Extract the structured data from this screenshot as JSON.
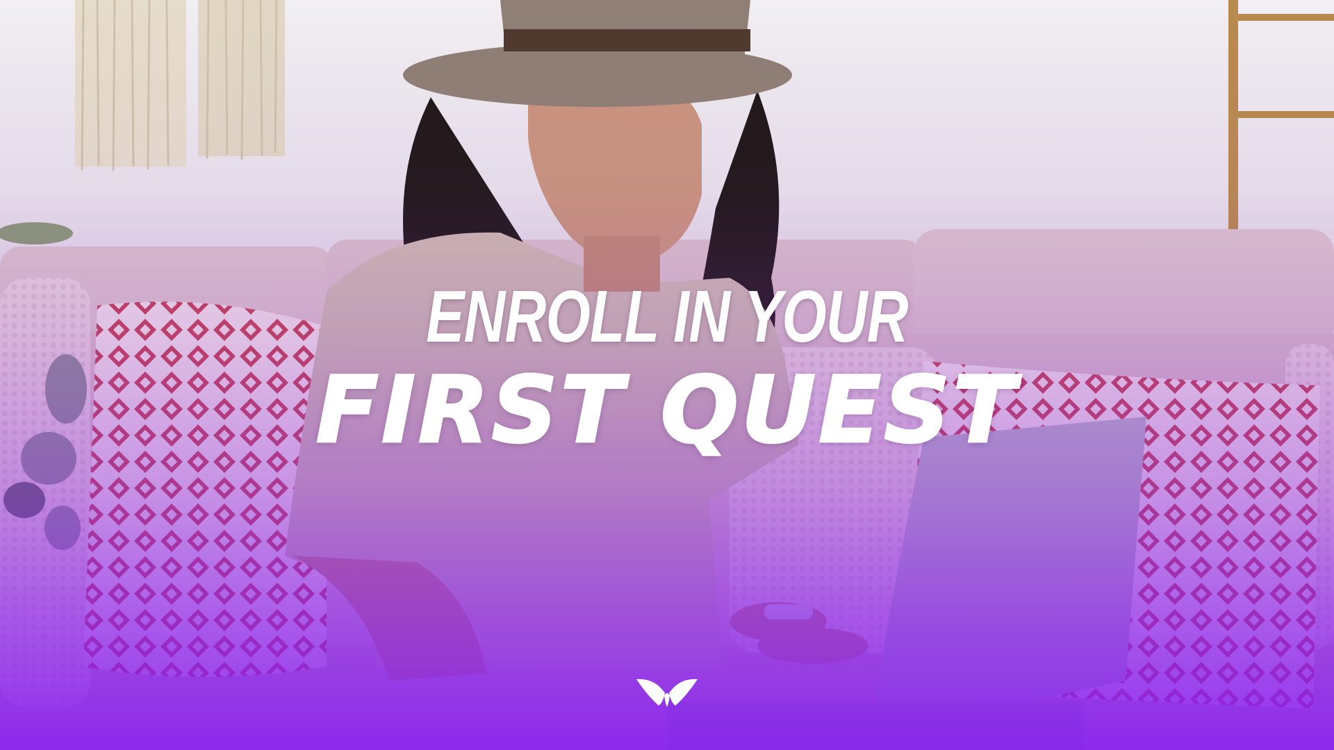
{
  "headline": {
    "line1": "ENROLL IN YOUR",
    "line2": "FIRST QUEST"
  },
  "logo": {
    "icon": "mindvalley-wings-icon"
  },
  "colors": {
    "overlay_purple": "#8a1ef0",
    "text": "#ffffff",
    "wall": "#ece9ef",
    "sofa": "#dcc4cc",
    "pillow_red": "#c4414e"
  }
}
